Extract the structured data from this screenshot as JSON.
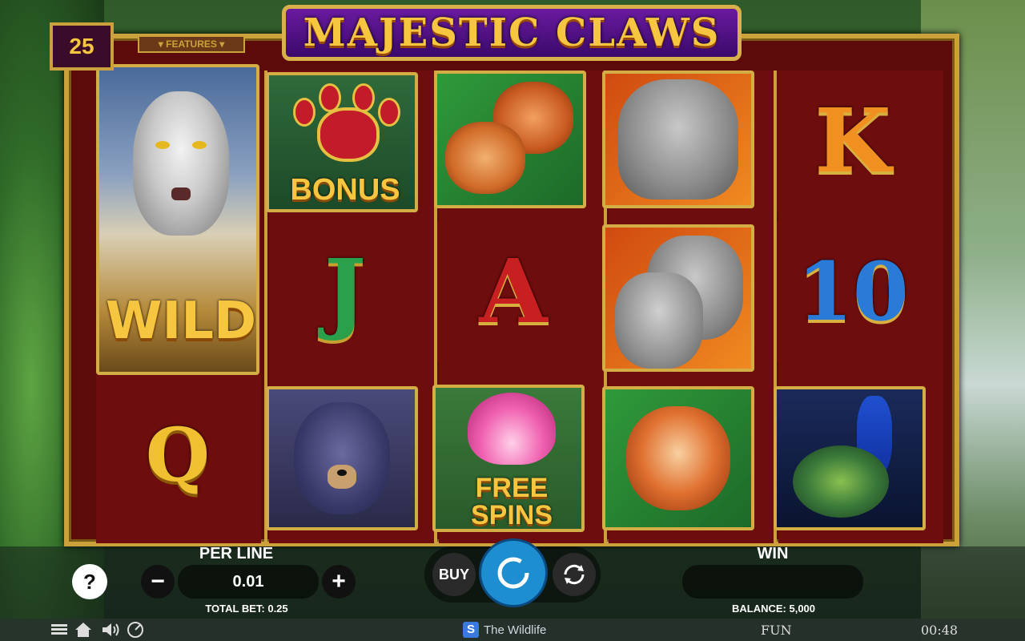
{
  "game": {
    "title": "MAJESTIC CLAWS",
    "lines": "25",
    "features_label": "▾ FEATURES ▾"
  },
  "reels": [
    {
      "symbols": [
        {
          "name": "tiger-wild",
          "text": "WILD"
        },
        {
          "name": "queen-q",
          "text": "Q"
        }
      ]
    },
    {
      "symbols": [
        {
          "name": "paw-bonus",
          "text": "BONUS"
        },
        {
          "name": "jack-j",
          "text": "J"
        },
        {
          "name": "bear",
          "text": ""
        }
      ]
    },
    {
      "symbols": [
        {
          "name": "red-pandas",
          "text": ""
        },
        {
          "name": "ace-a",
          "text": "A"
        },
        {
          "name": "lotus-free-spins",
          "text": "FREE SPINS"
        }
      ]
    },
    {
      "symbols": [
        {
          "name": "elephant",
          "text": ""
        },
        {
          "name": "elephants",
          "text": ""
        },
        {
          "name": "red-panda",
          "text": ""
        }
      ]
    },
    {
      "symbols": [
        {
          "name": "king-k",
          "text": "K"
        },
        {
          "name": "ten-10",
          "text": "10"
        },
        {
          "name": "peacock",
          "text": ""
        }
      ]
    }
  ],
  "controls": {
    "per_line_label": "PER LINE",
    "per_line_value": "0.01",
    "total_bet": "TOTAL BET: 0.25",
    "win_label": "WIN",
    "win_value": "",
    "balance": "BALANCE: 5,000",
    "buy_label": "BUY",
    "help_label": "?",
    "minus_label": "−",
    "plus_label": "+"
  },
  "footer": {
    "provider": "The Wildlife",
    "mode": "FUN",
    "clock": "00:48"
  },
  "colors": {
    "gold": "#caa13a",
    "reel_bg": "#6e0d0d",
    "title_purple": "#4a0f80"
  }
}
